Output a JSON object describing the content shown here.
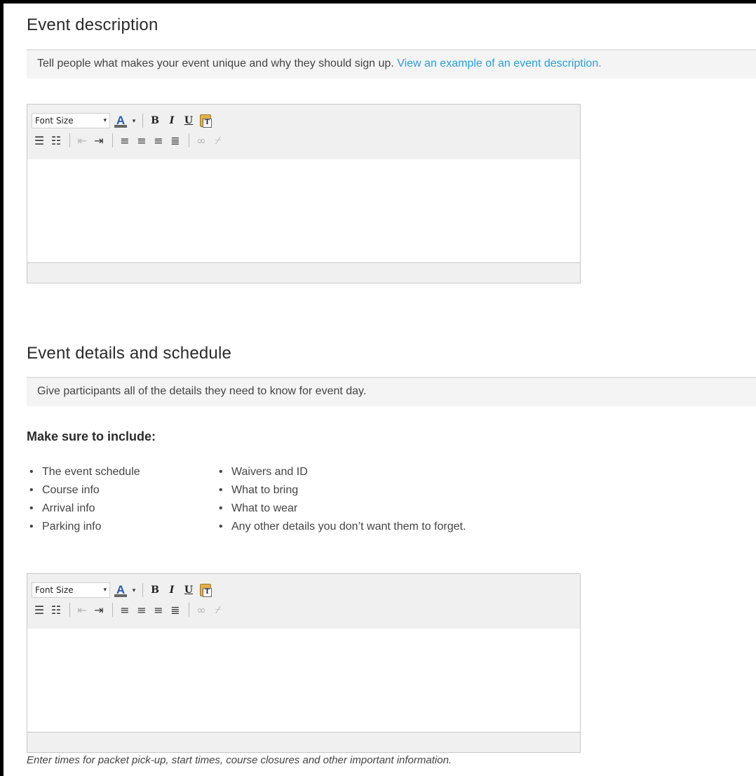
{
  "description_section": {
    "title": "Event description",
    "intro_text": "Tell people what makes your event unique and why they should sign up.",
    "intro_link": "View an example of an event description."
  },
  "schedule_section": {
    "title": "Event details and schedule",
    "intro_text": "Give participants all of the details they need to know for event day.",
    "include_heading": "Make sure to include:",
    "include_left": [
      "The event schedule",
      "Course info",
      "Arrival info",
      "Parking info"
    ],
    "include_right": [
      "Waivers and ID",
      "What to bring",
      "What to wear",
      "Any other details you don’t want them to forget."
    ],
    "helper_text": "Enter times for packet pick-up, start times, course closures and other important information."
  },
  "editor": {
    "font_size_label": "Font Size",
    "dropdown_arrow": "▾",
    "font_color_glyph": "A",
    "bold_glyph": "B",
    "italic_glyph": "I",
    "underline_glyph": "U",
    "bullet_list_glyph": "☰",
    "numbered_list_glyph": "☷",
    "outdent_glyph": "⇤",
    "indent_glyph": "⇥",
    "align_left_glyph": "≡",
    "align_center_glyph": "≡",
    "align_right_glyph": "≡",
    "justify_glyph": "≣",
    "link_glyph": "∞",
    "unlink_glyph": "⌿",
    "icons": [
      "font-color-icon",
      "bold-icon",
      "italic-icon",
      "underline-icon",
      "paste-text-icon",
      "bullet-list-icon",
      "numbered-list-icon",
      "outdent-icon",
      "indent-icon",
      "align-left-icon",
      "align-center-icon",
      "align-right-icon",
      "justify-icon",
      "link-icon",
      "unlink-icon"
    ]
  },
  "colors": {
    "link": "#2a9fd6",
    "band_bg": "#f4f4f4",
    "toolbar_bg": "#f0f0f0"
  }
}
